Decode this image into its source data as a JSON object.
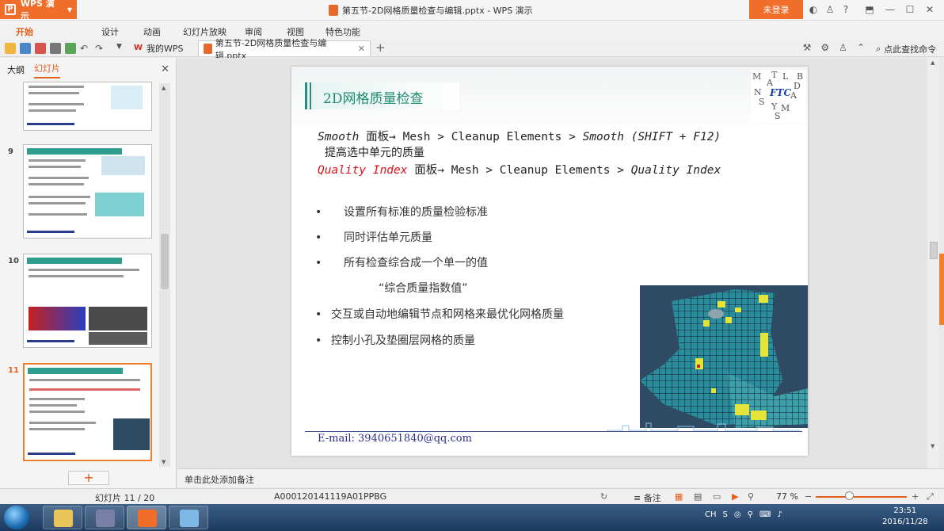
{
  "titlebar": {
    "app_name": "WPS 演示",
    "document_title": "第五节-2D网格质量检查与编辑.pptx - WPS 演示",
    "login": "未登录"
  },
  "menu": {
    "items": [
      "开始",
      "设计",
      "动画",
      "幻灯片放映",
      "审阅",
      "视图",
      "特色功能"
    ]
  },
  "tabs": {
    "my_wps": "我的WPS",
    "document": "第五节-2D网格质量检查与编辑.pptx",
    "find_command": "点此查找命令"
  },
  "left_panel": {
    "tab_outline": "大纲",
    "tab_slides": "幻灯片",
    "slide_numbers": [
      "9",
      "10",
      "11"
    ]
  },
  "slide": {
    "title": "2D网格质量检查",
    "logo_letters": [
      "M",
      "T",
      "L",
      "A",
      "B",
      "D",
      "N",
      "A",
      "S",
      "Y",
      "M",
      "S"
    ],
    "logo_center": "FTC",
    "line1": {
      "smooth": "Smooth",
      "panel": " 面板→ ",
      "path": "Mesh > Cleanup Elements > ",
      "smooth2": "Smooth",
      "shortcut": " (SHIFT + F12)"
    },
    "line2": "提高选中单元的质量",
    "line3": {
      "quality": "Quality Index",
      "panel": " 面板→ ",
      "path": "Mesh > Cleanup Elements > ",
      "quality2": "Quality Index"
    },
    "bullets": [
      "设置所有标准的质量检验标准",
      "同时评估单元质量",
      "所有检查综合成一个单一的值"
    ],
    "quote": "“综合质量指数值”",
    "bullets2": [
      "交互或自动地编辑节点和网格来最优化网格质量",
      "控制小孔及垫圈层网格的质量"
    ],
    "email": "E-mail: 3940651840@qq.com"
  },
  "notes": {
    "placeholder": "单击此处添加备注"
  },
  "status": {
    "slide_pos": "幻灯片 11 / 20",
    "template": "A000120141119A01PPBG",
    "notes": "备注",
    "zoom": "77 %"
  },
  "taskbar": {
    "lang": "CH",
    "time": "23:51",
    "date": "2016/11/28"
  },
  "colors": {
    "accent": "#f06d2a",
    "title_green": "#1f8b6f",
    "red_text": "#e0111a",
    "email_blue": "#2c2c8c"
  }
}
